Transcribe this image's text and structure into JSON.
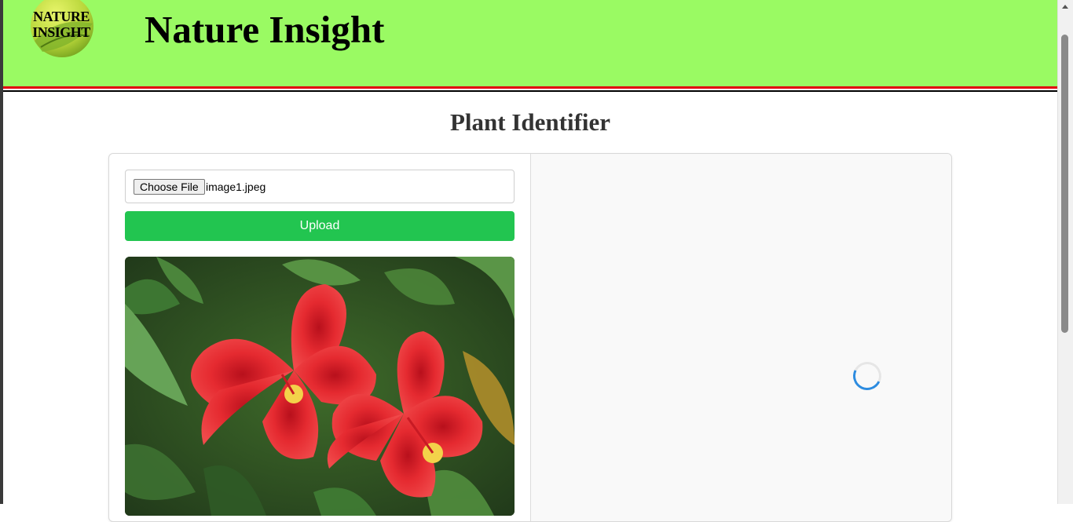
{
  "header": {
    "logo_text_line1": "NATURE",
    "logo_text_line2": "INSIGHT",
    "title": "Nature Insight",
    "background_color": "#9afa63",
    "rule_colors": [
      "#e1000f",
      "#000000"
    ]
  },
  "main": {
    "title": "Plant Identifier"
  },
  "uploader": {
    "choose_file_label": "Choose File",
    "file_name": "image1.jpeg",
    "upload_label": "Upload",
    "upload_color": "#22c550"
  },
  "preview": {
    "image_icon": "hibiscus-photo-icon"
  },
  "results": {
    "loading_icon": "spinner-icon",
    "accent_color": "#2d8ce0"
  }
}
